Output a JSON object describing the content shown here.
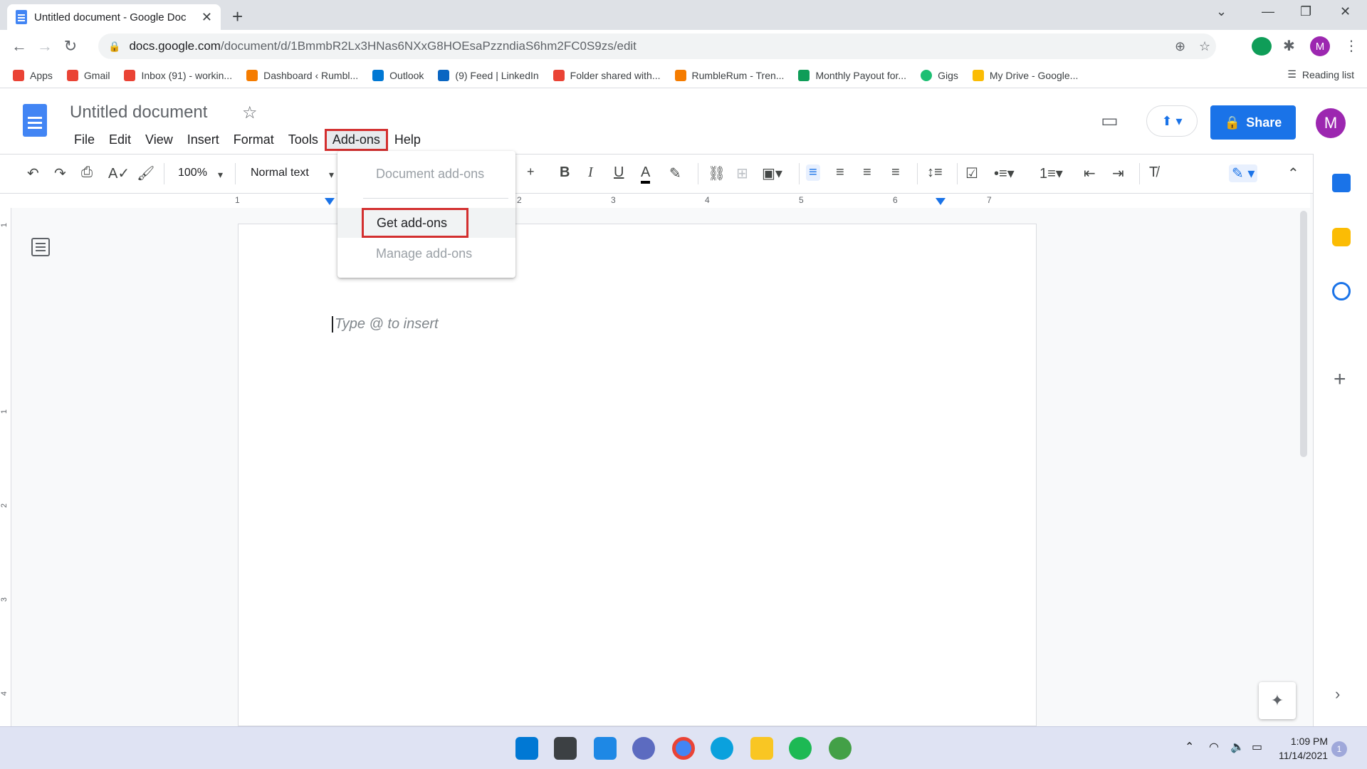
{
  "browser": {
    "tab_title": "Untitled document - Google Doc",
    "url_host": "docs.google.com",
    "url_path": "/document/d/1BmmbR2Lx3HNas6NXxG8HOEsaPzzndiaS6hm2FC0S9zs/edit",
    "profile_initial": "M"
  },
  "bookmarks": {
    "items": [
      {
        "label": "Apps",
        "color": "#ea4335"
      },
      {
        "label": "Gmail",
        "color": "#ea4335"
      },
      {
        "label": "Inbox (91) - workin...",
        "color": "#ea4335"
      },
      {
        "label": "Dashboard ‹ Rumbl...",
        "color": "#f57c00"
      },
      {
        "label": "Outlook",
        "color": "#0078d4"
      },
      {
        "label": "(9) Feed | LinkedIn",
        "color": "#0a66c2"
      },
      {
        "label": "Folder shared with...",
        "color": "#ea4335"
      },
      {
        "label": "RumbleRum - Tren...",
        "color": "#f57c00"
      },
      {
        "label": "Monthly Payout for...",
        "color": "#0f9d58"
      },
      {
        "label": "Gigs",
        "color": "#1dbf73"
      },
      {
        "label": "My Drive - Google...",
        "color": "#fbbc04"
      }
    ],
    "reading_list": "Reading list"
  },
  "docs": {
    "title": "Untitled document",
    "menus": [
      "File",
      "Edit",
      "View",
      "Insert",
      "Format",
      "Tools",
      "Add-ons",
      "Help"
    ],
    "share_label": "Share",
    "avatar_initial": "M"
  },
  "toolbar": {
    "zoom": "100%",
    "style": "Normal text"
  },
  "ruler": {
    "numbers": [
      "1",
      "2",
      "3",
      "4",
      "5",
      "6",
      "7"
    ],
    "vnumbers": [
      "1",
      "1",
      "2",
      "3",
      "4"
    ]
  },
  "document": {
    "placeholder": "Type @ to insert"
  },
  "addons_menu": {
    "document_addons": "Document add-ons",
    "get_addons": "Get add-ons",
    "manage_addons": "Manage add-ons"
  },
  "taskbar": {
    "time": "1:09 PM",
    "date": "11/14/2021",
    "notifications": "1"
  },
  "colors": {
    "accent": "#1a73e8",
    "highlight_box": "#d32f2f"
  }
}
